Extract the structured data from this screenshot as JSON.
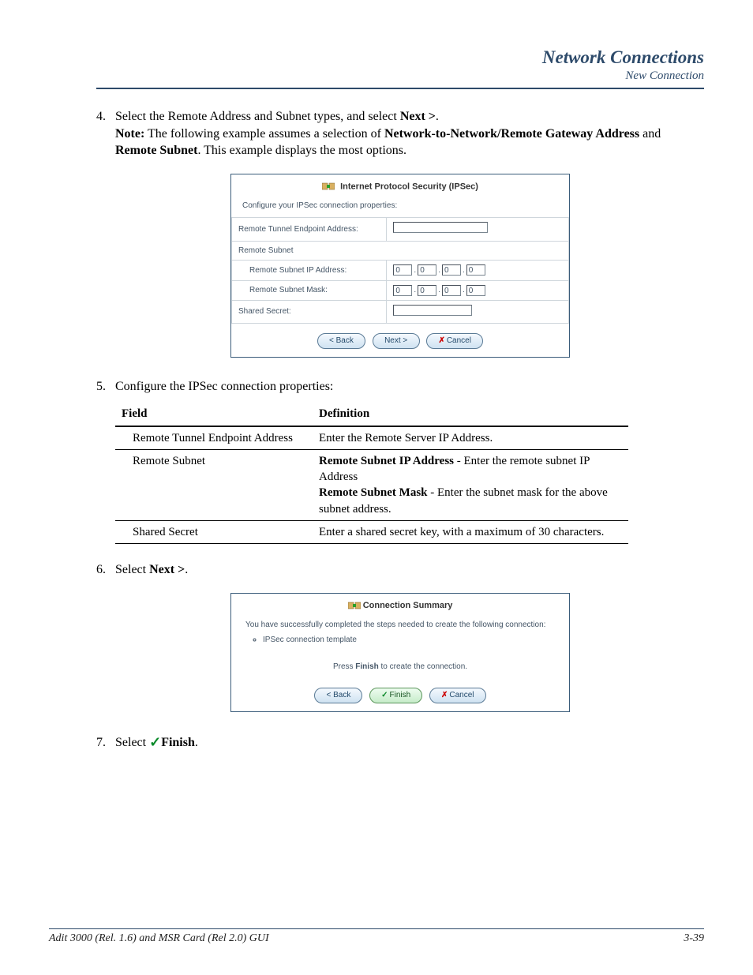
{
  "header": {
    "chapter": "Network Connections",
    "section": "New Connection"
  },
  "steps": {
    "s4": {
      "num": "4.",
      "text_a": "Select the Remote Address and Subnet types, and select ",
      "text_b": "Next >",
      "text_c": ".",
      "note_label": "Note:",
      "note_a": " The following example assumes a selection of ",
      "note_b": "Network-to-Network/Remote Gateway Address",
      "note_c": " and ",
      "note_d": "Remote Subnet",
      "note_e": ". This example displays the most options."
    },
    "s5": {
      "num": "5.",
      "text": "Configure the IPSec connection properties:"
    },
    "s6": {
      "num": "6.",
      "text_a": "Select ",
      "text_b": "Next >",
      "text_c": "."
    },
    "s7": {
      "num": "7.",
      "text_a": "Select ",
      "text_b": "Finish",
      "text_c": "."
    }
  },
  "fig1": {
    "title": "Internet Protocol Security (IPSec)",
    "subtitle": "Configure your IPSec connection properties:",
    "rows": {
      "r1": "Remote Tunnel Endpoint Address:",
      "r2": "Remote Subnet",
      "r3": "Remote Subnet IP Address:",
      "r4": "Remote Subnet Mask:",
      "r5": "Shared Secret:"
    },
    "octet": "0",
    "buttons": {
      "back": "< Back",
      "next": "Next >",
      "cancel": "Cancel"
    }
  },
  "deftable": {
    "head_field": "Field",
    "head_def": "Definition",
    "rows": [
      {
        "field": "Remote Tunnel Endpoint Address",
        "def_plain": "Enter the Remote Server IP Address."
      },
      {
        "field": "Remote Subnet",
        "b1": "Remote Subnet IP Address",
        "t1": " - Enter the remote subnet IP Address",
        "b2": "Remote Subnet Mask",
        "t2": " - Enter the subnet mask for the above subnet address."
      },
      {
        "field": "Shared Secret",
        "def_plain": "Enter a shared secret key, with a maximum of 30 characters."
      }
    ]
  },
  "fig2": {
    "title": "Connection Summary",
    "msg": "You have successfully completed the steps needed to create the following connection:",
    "bullet": "IPSec connection template",
    "press_a": "Press ",
    "press_b": "Finish",
    "press_c": " to create the connection.",
    "buttons": {
      "back": "< Back",
      "finish": "Finish",
      "cancel": "Cancel"
    }
  },
  "footer": {
    "left": "Adit 3000 (Rel. 1.6) and MSR Card (Rel 2.0) GUI",
    "right": "3-39"
  },
  "icons": {
    "ipsec": "ipsec-icon",
    "check": "✓",
    "cross": "✗"
  }
}
